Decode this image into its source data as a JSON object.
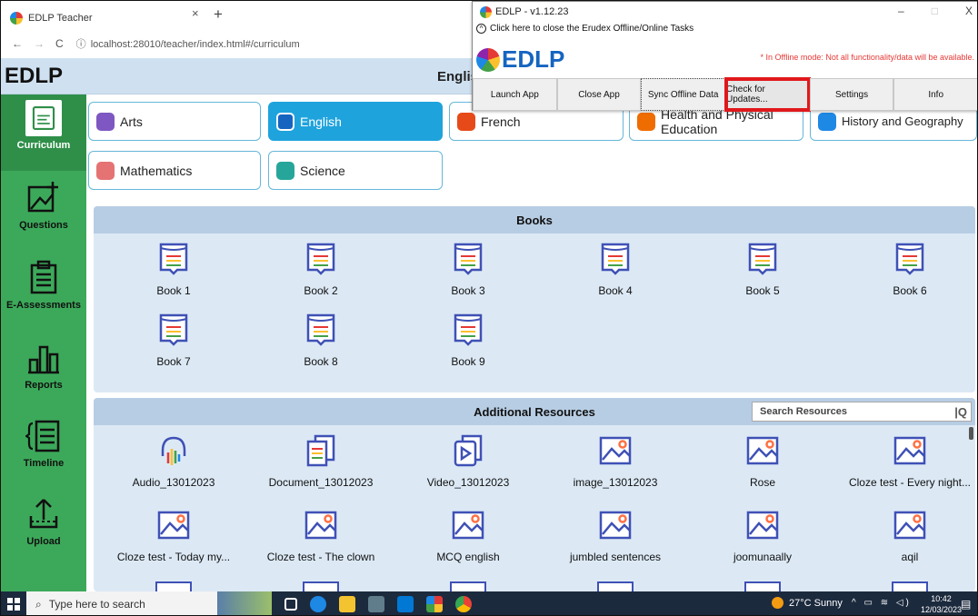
{
  "browser": {
    "tab_title": "EDLP Teacher",
    "tab_close": "×",
    "new_tab": "+",
    "url": "localhost:28010/teacher/index.html#/curriculum"
  },
  "app": {
    "logo": "EDLP",
    "title": "Englis"
  },
  "sidebar": {
    "items": [
      {
        "label": "Curriculum",
        "icon": "curriculum-icon",
        "active": true
      },
      {
        "label": "Questions",
        "icon": "add-question-icon"
      },
      {
        "label": "E-Assessments",
        "icon": "clipboard-icon"
      },
      {
        "label": "Reports",
        "icon": "reports-icon"
      },
      {
        "label": "Timeline",
        "icon": "timeline-icon"
      },
      {
        "label": "Upload",
        "icon": "upload-icon"
      }
    ]
  },
  "subjects": [
    {
      "label": "Arts",
      "color": "#7e57c2"
    },
    {
      "label": "English",
      "color": "#1976d2",
      "active": true
    },
    {
      "label": "French",
      "color": "#e64a19"
    },
    {
      "label": "Health and Physical Education",
      "color": "#ef6c00"
    },
    {
      "label": "History and Geography",
      "color": "#1e88e5"
    },
    {
      "label": "Mathematics",
      "color": "#e57373"
    },
    {
      "label": "Science",
      "color": "#26a69a"
    }
  ],
  "books": {
    "heading": "Books",
    "items": [
      "Book 1",
      "Book 2",
      "Book 3",
      "Book 4",
      "Book 5",
      "Book 6",
      "Book 7",
      "Book 8",
      "Book 9"
    ]
  },
  "resources": {
    "heading": "Additional Resources",
    "search_placeholder": "Search Resources",
    "items": [
      {
        "label": "Audio_13012023",
        "icon": "audio-icon"
      },
      {
        "label": "Document_13012023",
        "icon": "document-icon"
      },
      {
        "label": "Video_13012023",
        "icon": "video-icon"
      },
      {
        "label": "image_13012023",
        "icon": "image-icon"
      },
      {
        "label": "Rose",
        "icon": "image-icon"
      },
      {
        "label": "Cloze test - Every night...",
        "icon": "image-icon"
      },
      {
        "label": "Cloze test - Today my...",
        "icon": "image-icon"
      },
      {
        "label": "Cloze test - The clown",
        "icon": "image-icon"
      },
      {
        "label": "MCQ english",
        "icon": "image-icon"
      },
      {
        "label": "jumbled sentences",
        "icon": "image-icon"
      },
      {
        "label": "joomunaally",
        "icon": "image-icon"
      },
      {
        "label": "aqil",
        "icon": "image-icon"
      }
    ]
  },
  "popup": {
    "title": "EDLP - v1.12.23",
    "notice": "Click here to close the Erudex Offline/Online Tasks",
    "logo": "EDLP",
    "offline_note": "* In Offline mode: Not all functionality/data will be available.",
    "buttons": [
      "Launch App",
      "Close App",
      "Sync Offline Data",
      "Check for Updates...",
      "Settings",
      "Info"
    ],
    "window_controls": [
      "–",
      "□",
      "X"
    ]
  },
  "taskbar": {
    "search_placeholder": "Type here to search",
    "weather": "27°C  Sunny",
    "time": "10:42",
    "date": "12/03/2023"
  }
}
